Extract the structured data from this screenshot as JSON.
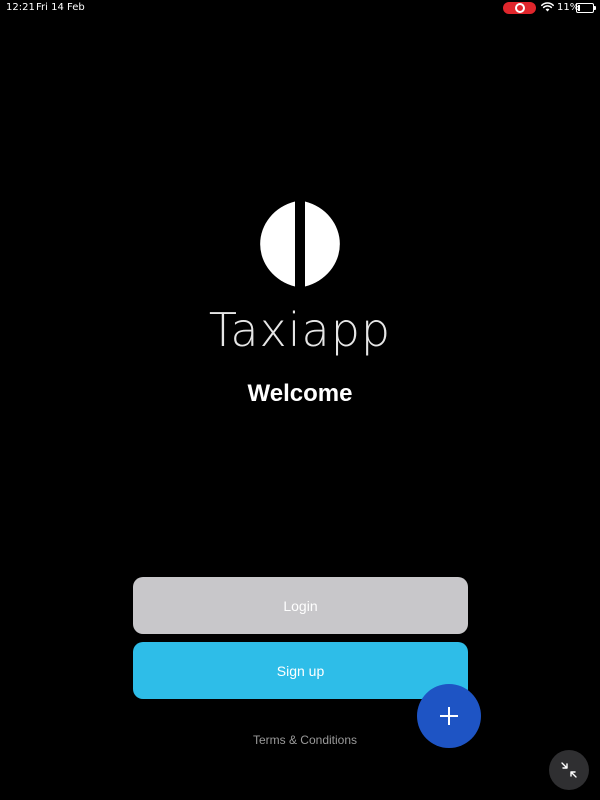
{
  "status_bar": {
    "time": "12:21",
    "date": "Fri 14 Feb",
    "battery_percent": "11%",
    "battery_level": 0.11,
    "recording_color": "#e0262c",
    "icons": [
      "screen-recording-icon",
      "wifi-icon",
      "battery-icon"
    ]
  },
  "brand": {
    "logo_icon": "taxiapp-logo-icon",
    "name": "Taxiapp"
  },
  "welcome": "Welcome",
  "buttons": {
    "login_label": "Login",
    "signup_label": "Sign up"
  },
  "terms_link": "Terms & Conditions",
  "fab": {
    "icon": "plus-icon",
    "color": "#1e54c4"
  },
  "collapse_icon": "collapse-arrows-icon",
  "colors": {
    "background": "#000000",
    "login_button": "#c8c7ca",
    "signup_button": "#2ebde8"
  }
}
